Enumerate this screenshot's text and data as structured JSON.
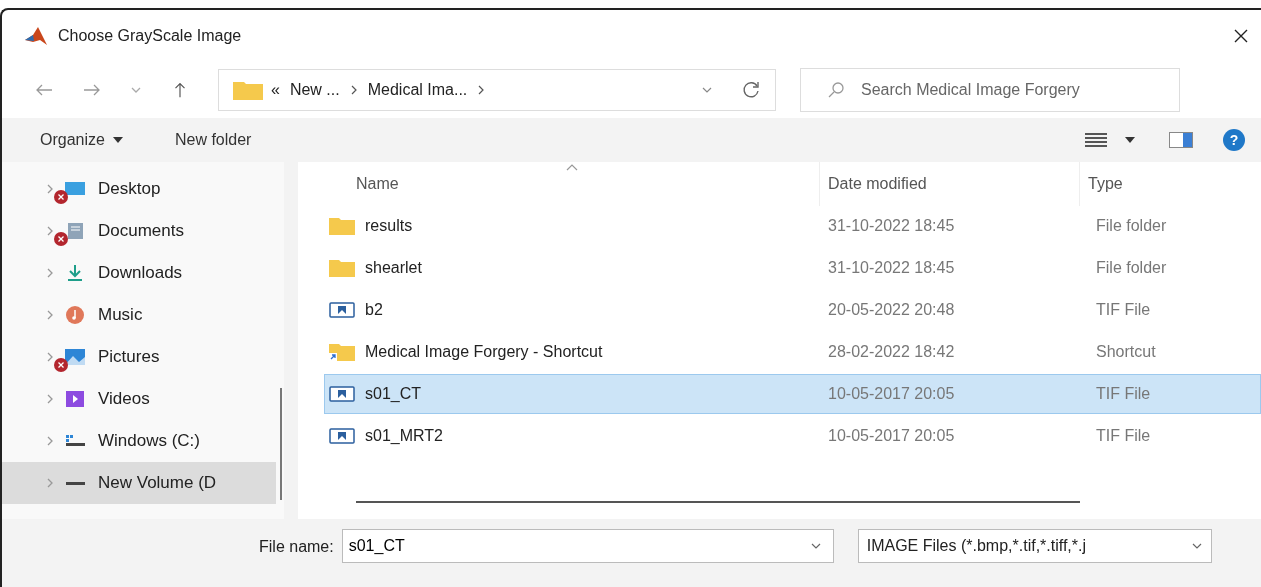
{
  "window": {
    "title": "Choose GrayScale Image"
  },
  "address": {
    "crumbs": [
      "New ...",
      "Medical Ima..."
    ],
    "overflow": "«"
  },
  "search": {
    "placeholder": "Search Medical Image Forgery"
  },
  "toolbar": {
    "organize": "Organize",
    "new_folder": "New folder",
    "help": "?"
  },
  "sidebar": {
    "items": [
      {
        "label": "Desktop",
        "kind": "desktop",
        "error": true,
        "selected": false
      },
      {
        "label": "Documents",
        "kind": "documents",
        "error": true,
        "selected": false
      },
      {
        "label": "Downloads",
        "kind": "downloads",
        "error": false,
        "selected": false
      },
      {
        "label": "Music",
        "kind": "music",
        "error": false,
        "selected": false
      },
      {
        "label": "Pictures",
        "kind": "pictures",
        "error": true,
        "selected": false
      },
      {
        "label": "Videos",
        "kind": "videos",
        "error": false,
        "selected": false
      },
      {
        "label": "Windows (C:)",
        "kind": "drive",
        "error": false,
        "selected": false
      },
      {
        "label": "New Volume (D",
        "kind": "volume",
        "error": false,
        "selected": true
      }
    ]
  },
  "table": {
    "columns": [
      "Name",
      "Date modified",
      "Type"
    ],
    "rows": [
      {
        "name": "results",
        "date": "31-10-2022 18:45",
        "type": "File folder",
        "kind": "folder",
        "selected": false
      },
      {
        "name": "shearlet",
        "date": "31-10-2022 18:45",
        "type": "File folder",
        "kind": "folder",
        "selected": false
      },
      {
        "name": "b2",
        "date": "20-05-2022 20:48",
        "type": "TIF File",
        "kind": "image",
        "selected": false
      },
      {
        "name": "Medical Image Forgery - Shortcut",
        "date": "28-02-2022 18:42",
        "type": "Shortcut",
        "kind": "shortcut",
        "selected": false
      },
      {
        "name": "s01_CT",
        "date": "10-05-2017 20:05",
        "type": "TIF File",
        "kind": "image",
        "selected": true
      },
      {
        "name": "s01_MRT2",
        "date": "10-05-2017 20:05",
        "type": "TIF File",
        "kind": "image",
        "selected": false
      }
    ]
  },
  "footer": {
    "file_name_label": "File name:",
    "file_name": "s01_CT",
    "filter": "IMAGE Files (*.bmp,*.tif,*.tiff,*.j"
  }
}
